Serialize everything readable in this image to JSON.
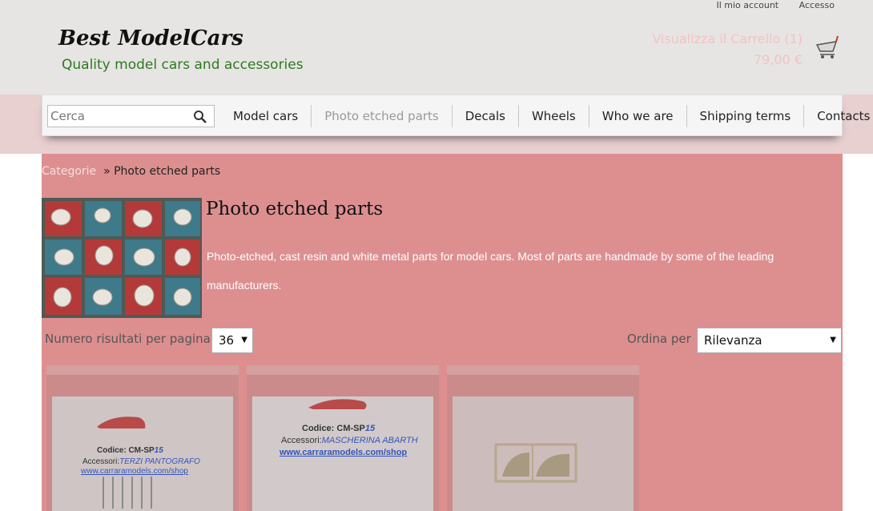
{
  "header": {
    "account_link": "Il mio account",
    "login_link": "Accesso",
    "logo_title": "Best ModelCars",
    "logo_subtitle": "Quality model cars and accessories",
    "cart_label": "Visualizza il Carrello (1)",
    "cart_total": "79,00 €",
    "cart_icon": "shopping-cart-icon"
  },
  "search": {
    "placeholder": "Cerca",
    "icon": "search-icon"
  },
  "nav": {
    "items": [
      {
        "label": "Model cars"
      },
      {
        "label": "Photo etched parts"
      },
      {
        "label": "Decals"
      },
      {
        "label": "Wheels"
      },
      {
        "label": "Who we are"
      },
      {
        "label": "Shipping terms"
      },
      {
        "label": "Contacts"
      }
    ],
    "active_index": 1
  },
  "breadcrumb": {
    "root": "Categorie",
    "separator": "»",
    "current": "Photo etched parts"
  },
  "category": {
    "title": "Photo etched parts",
    "description": "Photo-etched, cast resin and white metal parts for model cars. Most of parts are handmade by some of the leading manufacturers."
  },
  "listing": {
    "per_page_label": "Numero risultati per pagina",
    "per_page_value": "36",
    "sort_label": "Ordina per",
    "sort_value": "Rilevanza"
  },
  "products": [
    {
      "code_line": "Codice: CM-SP",
      "code_hand": "15",
      "accessori_line": "Accessori:",
      "accessori_hand": "TERZI PANTOGRAFO",
      "url": "www.carraramodels.com/shop"
    },
    {
      "code_line": "Codice: CM-SP",
      "code_hand": "15",
      "accessori_line": "Accessori:",
      "accessori_hand": "MASCHERINA ABARTH",
      "url": "www.carraramodels.com/shop"
    },
    {
      "code_line": "",
      "code_hand": "",
      "accessori_line": "",
      "accessori_hand": "",
      "url": ""
    }
  ],
  "colors": {
    "accent_green": "#2d7a1e",
    "content_bg": "#dd8f90",
    "nav_band": "#e8cfd0",
    "cart_text": "#f2c3c3"
  }
}
